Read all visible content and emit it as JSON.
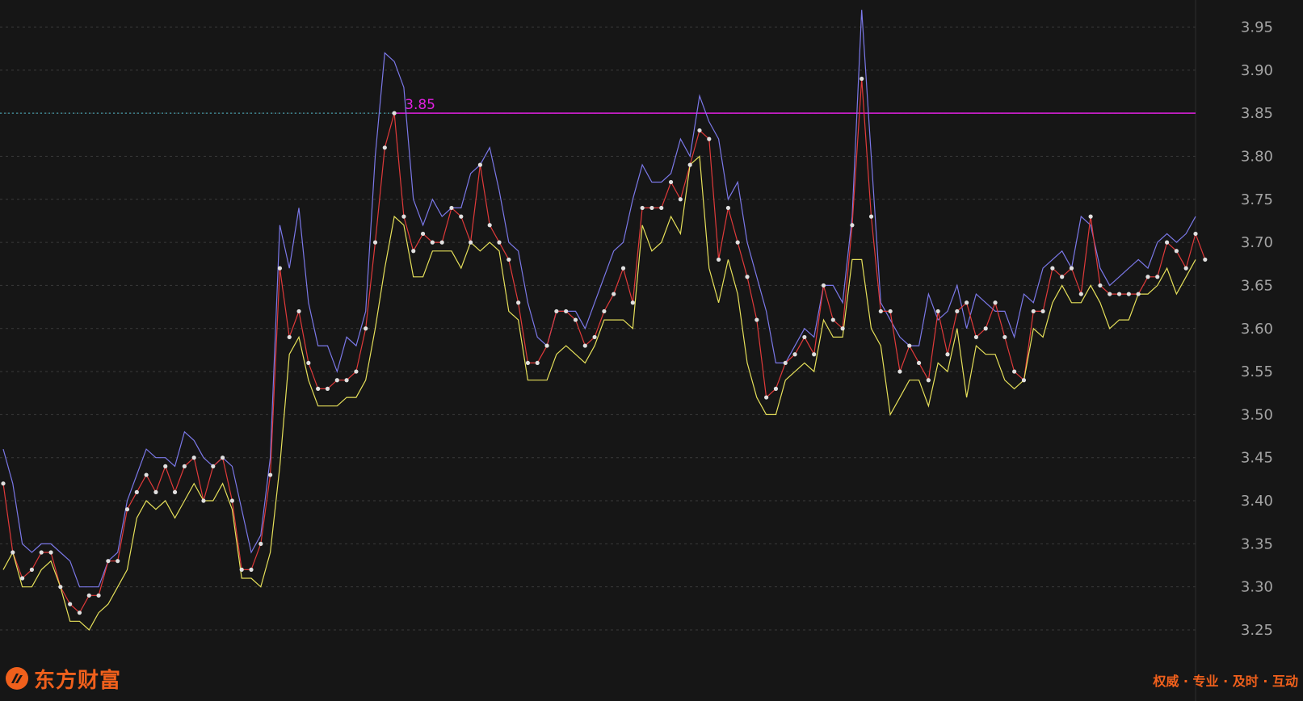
{
  "brand": {
    "name": "东方财富",
    "slogan": "权威 · 专业 · 及时 · 互动",
    "color": "#f0601c",
    "logo_icon": "eastmoney-logo-icon"
  },
  "colors": {
    "background": "#161616",
    "grid": "#3a3a3a",
    "upper_line": "#7b78e8",
    "middle_line": "#e03a3a",
    "lower_line": "#e6e05a",
    "marker": "#e0e0e0",
    "reference_line": "#e020e0"
  },
  "chart_data": {
    "type": "line",
    "title": "",
    "xlabel": "",
    "ylabel": "",
    "ylim": [
      3.22,
      3.98
    ],
    "yticks": [
      "3.25",
      "3.30",
      "3.35",
      "3.40",
      "3.45",
      "3.50",
      "3.55",
      "3.60",
      "3.65",
      "3.70",
      "3.75",
      "3.80",
      "3.85",
      "3.90",
      "3.95"
    ],
    "grid": true,
    "axis_position": "right",
    "reference_line": {
      "value": 3.85,
      "label": "3.85"
    },
    "series": [
      {
        "role": "high",
        "values": [
          3.46,
          3.42,
          3.35,
          3.34,
          3.35,
          3.35,
          3.34,
          3.33,
          3.3,
          3.3,
          3.3,
          3.33,
          3.34,
          3.4,
          3.43,
          3.46,
          3.45,
          3.45,
          3.44,
          3.48,
          3.47,
          3.45,
          3.44,
          3.45,
          3.44,
          3.39,
          3.34,
          3.36,
          3.45,
          3.72,
          3.67,
          3.74,
          3.63,
          3.58,
          3.58,
          3.55,
          3.59,
          3.58,
          3.62,
          3.8,
          3.92,
          3.91,
          3.88,
          3.75,
          3.72,
          3.75,
          3.73,
          3.74,
          3.74,
          3.78,
          3.79,
          3.81,
          3.76,
          3.7,
          3.69,
          3.63,
          3.59,
          3.58,
          3.62,
          3.62,
          3.62,
          3.6,
          3.63,
          3.66,
          3.69,
          3.7,
          3.75,
          3.79,
          3.77,
          3.77,
          3.78,
          3.82,
          3.8,
          3.87,
          3.84,
          3.82,
          3.75,
          3.77,
          3.7,
          3.66,
          3.62,
          3.56,
          3.56,
          3.58,
          3.6,
          3.59,
          3.65,
          3.65,
          3.63,
          3.73,
          3.97,
          3.8,
          3.63,
          3.61,
          3.59,
          3.58,
          3.58,
          3.64,
          3.61,
          3.62,
          3.65,
          3.6,
          3.64,
          3.63,
          3.62,
          3.62,
          3.59,
          3.64,
          3.63,
          3.67,
          3.68,
          3.69,
          3.67,
          3.73,
          3.72,
          3.67,
          3.65,
          3.66,
          3.67,
          3.68,
          3.67,
          3.7,
          3.71,
          3.7,
          3.71,
          3.73
        ]
      },
      {
        "role": "close",
        "values": [
          3.42,
          3.34,
          3.31,
          3.32,
          3.34,
          3.34,
          3.3,
          3.28,
          3.27,
          3.29,
          3.29,
          3.33,
          3.33,
          3.39,
          3.41,
          3.43,
          3.41,
          3.44,
          3.41,
          3.44,
          3.45,
          3.4,
          3.44,
          3.45,
          3.4,
          3.32,
          3.32,
          3.35,
          3.43,
          3.67,
          3.59,
          3.62,
          3.56,
          3.53,
          3.53,
          3.54,
          3.54,
          3.55,
          3.6,
          3.7,
          3.81,
          3.85,
          3.73,
          3.69,
          3.71,
          3.7,
          3.7,
          3.74,
          3.73,
          3.7,
          3.79,
          3.72,
          3.7,
          3.68,
          3.63,
          3.56,
          3.56,
          3.58,
          3.62,
          3.62,
          3.61,
          3.58,
          3.59,
          3.62,
          3.64,
          3.67,
          3.63,
          3.74,
          3.74,
          3.74,
          3.77,
          3.75,
          3.79,
          3.83,
          3.82,
          3.68,
          3.74,
          3.7,
          3.66,
          3.61,
          3.52,
          3.53,
          3.56,
          3.57,
          3.59,
          3.57,
          3.65,
          3.61,
          3.6,
          3.72,
          3.89,
          3.73,
          3.62,
          3.62,
          3.55,
          3.58,
          3.56,
          3.54,
          3.62,
          3.57,
          3.62,
          3.63,
          3.59,
          3.6,
          3.63,
          3.59,
          3.55,
          3.54,
          3.62,
          3.62,
          3.67,
          3.66,
          3.67,
          3.64,
          3.73,
          3.65,
          3.64,
          3.64,
          3.64,
          3.64,
          3.66,
          3.66,
          3.7,
          3.69,
          3.67,
          3.71,
          3.68
        ]
      },
      {
        "role": "low",
        "values": [
          3.32,
          3.34,
          3.3,
          3.3,
          3.32,
          3.33,
          3.3,
          3.26,
          3.26,
          3.25,
          3.27,
          3.28,
          3.3,
          3.32,
          3.38,
          3.4,
          3.39,
          3.4,
          3.38,
          3.4,
          3.42,
          3.4,
          3.4,
          3.42,
          3.39,
          3.31,
          3.31,
          3.3,
          3.34,
          3.44,
          3.57,
          3.59,
          3.54,
          3.51,
          3.51,
          3.51,
          3.52,
          3.52,
          3.54,
          3.6,
          3.67,
          3.73,
          3.72,
          3.66,
          3.66,
          3.69,
          3.69,
          3.69,
          3.67,
          3.7,
          3.69,
          3.7,
          3.69,
          3.62,
          3.61,
          3.54,
          3.54,
          3.54,
          3.57,
          3.58,
          3.57,
          3.56,
          3.58,
          3.61,
          3.61,
          3.61,
          3.6,
          3.72,
          3.69,
          3.7,
          3.73,
          3.71,
          3.79,
          3.8,
          3.67,
          3.63,
          3.68,
          3.64,
          3.56,
          3.52,
          3.5,
          3.5,
          3.54,
          3.55,
          3.56,
          3.55,
          3.61,
          3.59,
          3.59,
          3.68,
          3.68,
          3.6,
          3.58,
          3.5,
          3.52,
          3.54,
          3.54,
          3.51,
          3.56,
          3.55,
          3.6,
          3.52,
          3.58,
          3.57,
          3.57,
          3.54,
          3.53,
          3.54,
          3.6,
          3.59,
          3.63,
          3.65,
          3.63,
          3.63,
          3.65,
          3.63,
          3.6,
          3.61,
          3.61,
          3.64,
          3.64,
          3.65,
          3.67,
          3.64,
          3.66,
          3.68
        ]
      }
    ]
  }
}
